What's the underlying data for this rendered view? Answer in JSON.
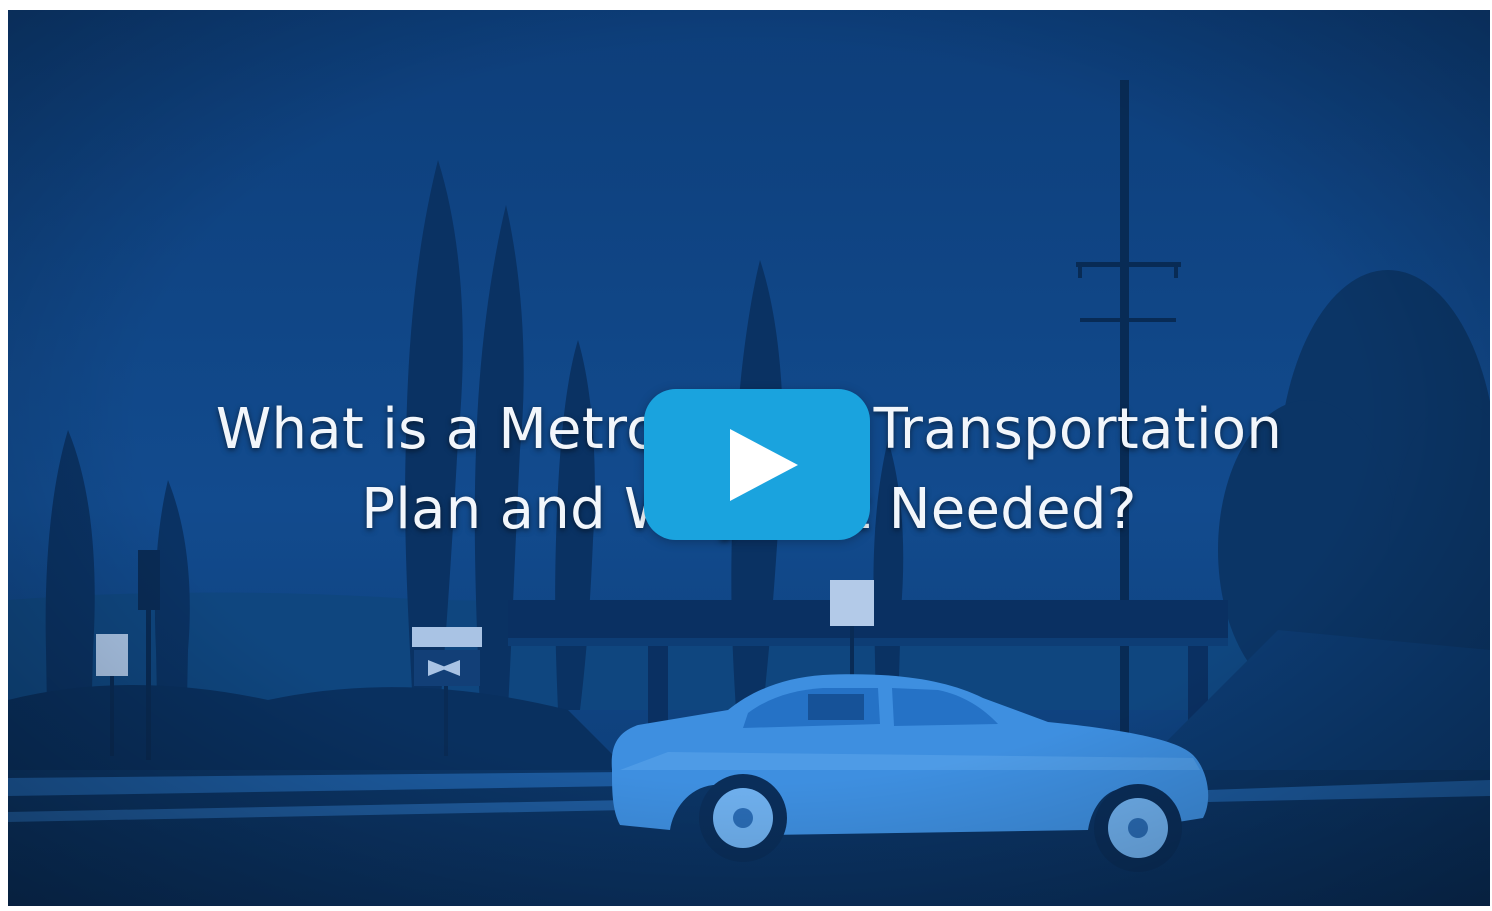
{
  "video": {
    "title_line1": "What is a Metropolitan Transportation",
    "title_line2": "Plan and Why Is It Needed?",
    "play_icon": "play-icon",
    "play_button_color": "#1aa3de",
    "overlay_tint": "#0d3f7c"
  }
}
